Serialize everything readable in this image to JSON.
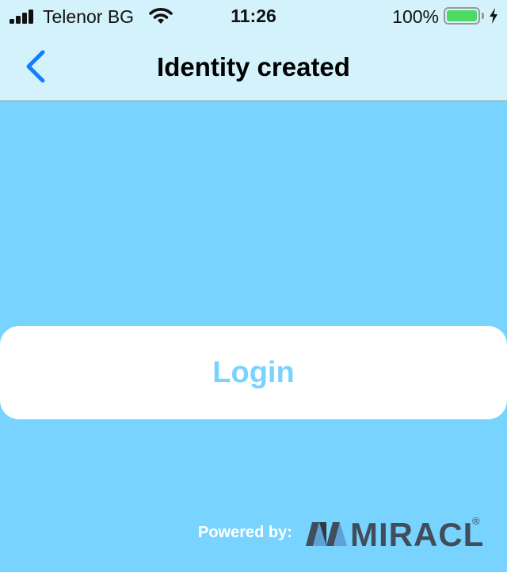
{
  "status_bar": {
    "carrier": "Telenor BG",
    "time": "11:26",
    "battery_percent": "100%",
    "signal_icon": "cellular-signal-icon",
    "wifi_icon": "wifi-icon",
    "battery_icon": "battery-icon",
    "battery_level": 1.0,
    "charging_icon": "charging-bolt-icon"
  },
  "nav": {
    "title": "Identity created",
    "back_icon": "chevron-left-icon"
  },
  "main": {
    "login_label": "Login"
  },
  "footer": {
    "powered_by": "Powered by:",
    "brand_name": "MIRACL",
    "brand_mark": "®"
  },
  "colors": {
    "background": "#78d4fe",
    "header_background": "#d3f2fb",
    "accent": "#147efb",
    "button_background": "#ffffff",
    "button_text": "#78d4fe",
    "battery_fill": "#4cd964",
    "brand": "#414d5a"
  }
}
